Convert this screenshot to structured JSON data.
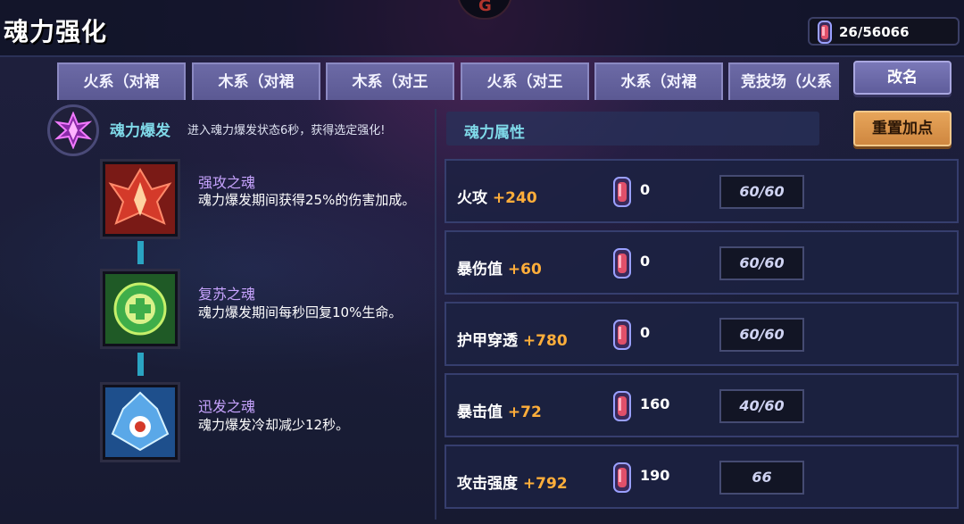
{
  "header": {
    "title": "魂力强化",
    "emblem_glyph": "G",
    "currency": {
      "value": "26/56066",
      "icon": "soul-crystal-icon"
    }
  },
  "tabs": [
    {
      "label": "火系（对裙"
    },
    {
      "label": "木系（对裙"
    },
    {
      "label": "木系（对王"
    },
    {
      "label": "火系（对王"
    },
    {
      "label": "水系（对裙"
    },
    {
      "label": "竞技场（火系"
    }
  ],
  "rename_button": "改名",
  "burst": {
    "title": "魂力爆发",
    "description": "进入魂力爆发状态6秒，获得选定强化!",
    "icon": "soul-burst-crystal-icon"
  },
  "souls": [
    {
      "name": "强攻之魂",
      "description": "魂力爆发期间获得25%的伤害加成。",
      "icon": "attack-soul-icon",
      "color": "#d43a2a"
    },
    {
      "name": "复苏之魂",
      "description": "魂力爆发期间每秒回复10%生命。",
      "icon": "revive-soul-icon",
      "color": "#3fae4a"
    },
    {
      "name": "迅发之魂",
      "description": "魂力爆发冷却减少12秒。",
      "icon": "swift-soul-icon",
      "color": "#5aa8e8"
    }
  ],
  "attributes": {
    "header": "魂力属性",
    "reset_button": "重置加点",
    "rows": [
      {
        "name": "火攻",
        "bonus": "+240",
        "points": "0",
        "cap": "60/60"
      },
      {
        "name": "暴伤值",
        "bonus": "+60",
        "points": "0",
        "cap": "60/60"
      },
      {
        "name": "护甲穿透",
        "bonus": "+780",
        "points": "0",
        "cap": "60/60"
      },
      {
        "name": "暴击值",
        "bonus": "+72",
        "points": "160",
        "cap": "40/60"
      },
      {
        "name": "攻击强度",
        "bonus": "+792",
        "points": "190",
        "cap": "66"
      }
    ]
  },
  "colors": {
    "accent_cyan": "#7fd9e8",
    "bonus_orange": "#ffae3a",
    "soul_name_purple": "#c8a4ff",
    "reset_orange": "#e7a55a",
    "tab_purple": "#6c6aa6"
  }
}
